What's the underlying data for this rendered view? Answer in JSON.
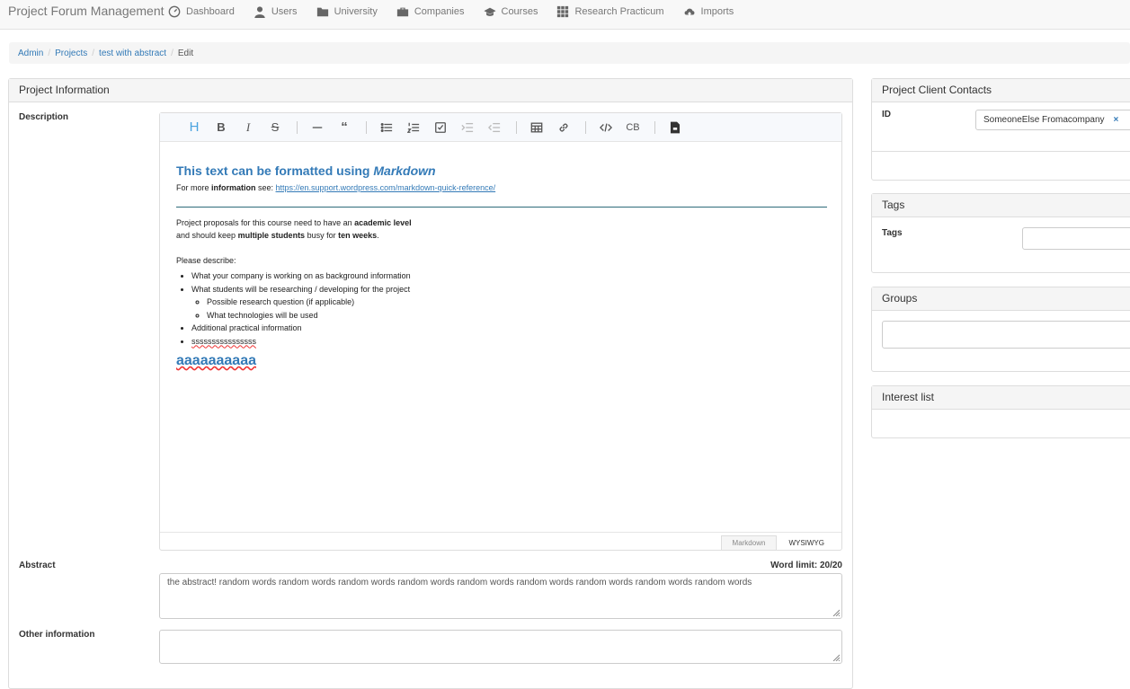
{
  "navbar": {
    "brand": "Project Forum Management",
    "items": [
      {
        "label": "Dashboard",
        "icon": "dashboard-icon"
      },
      {
        "label": "Users",
        "icon": "user-icon"
      },
      {
        "label": "University",
        "icon": "folder-icon"
      },
      {
        "label": "Companies",
        "icon": "briefcase-icon"
      },
      {
        "label": "Courses",
        "icon": "graduation-cap-icon"
      },
      {
        "label": "Research Practicum",
        "icon": "grid-icon"
      },
      {
        "label": "Imports",
        "icon": "cloud-upload-icon"
      }
    ]
  },
  "breadcrumb": {
    "items": [
      "Admin",
      "Projects",
      "test with abstract"
    ],
    "current": "Edit"
  },
  "main": {
    "panel_title": "Project Information",
    "description_label": "Description",
    "editor": {
      "title_plain": "This text can be formatted using ",
      "title_em": "Markdown",
      "more_info_prefix": "For more ",
      "more_info_bold": "information",
      "more_info_suffix": " see: ",
      "more_info_link": "https://en.support.wordpress.com/markdown-quick-reference/",
      "para1_a": "Project proposals for this course need to have an ",
      "para1_b": "academic level",
      "para2_a": "and should keep ",
      "para2_b": "multiple students",
      "para2_c": " busy for ",
      "para2_d": "ten weeks",
      "para2_e": ".",
      "describe": "Please describe:",
      "bullets": {
        "b1": "What your company is working on as background information",
        "b2": "What students will be researching / developing for the project",
        "b2_sub1": "Possible research question (if applicable)",
        "b2_sub2": "What technologies will be used",
        "b3": "Additional practical information",
        "b4": "ssssssssssssssss"
      },
      "heading2": "aaaaaaaaaa",
      "mode_markdown": "Markdown",
      "mode_wysiwyg": "WYSIWYG"
    },
    "abstract_label": "Abstract",
    "word_limit": "Word limit: 20/20",
    "abstract_value": "the abstract! random words random words random words random words random words random words random words random words random words",
    "other_info_label": "Other information"
  },
  "right": {
    "client_contacts_title": "Project Client Contacts",
    "id_label": "ID",
    "contact_chip": "SomeoneElse Fromacompany",
    "contact_remove": "×",
    "tags_title": "Tags",
    "tags_label": "Tags",
    "groups_title": "Groups",
    "interest_title": "Interest list"
  },
  "colors": {
    "accent": "#337ab7",
    "heading_icon": "#4aa3df"
  }
}
